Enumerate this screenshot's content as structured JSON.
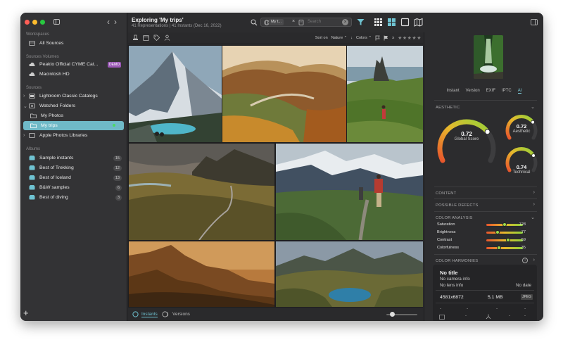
{
  "sidebar": {
    "workspaces_header": "Workspaces",
    "all_sources": "All Sources",
    "sources_volumes_header": "Sources Volumes",
    "volumes": [
      {
        "label": "Peakto Official CYME Cat...",
        "badge": "DEMO"
      },
      {
        "label": "Macintosh HD",
        "badge": ""
      }
    ],
    "sources_header": "Sources",
    "sources": [
      {
        "label": "Lightroom Classic Catalogs"
      },
      {
        "label": "Watched Folders"
      },
      {
        "label": "My Photos"
      },
      {
        "label": "My trips"
      },
      {
        "label": "Apple Photos Libraries"
      }
    ],
    "albums_header": "Albums",
    "albums": [
      {
        "label": "Sample instants",
        "count": "15"
      },
      {
        "label": "Best of Trekking",
        "count": "12"
      },
      {
        "label": "Best of Iceland",
        "count": "13"
      },
      {
        "label": "B&W samples",
        "count": "6"
      },
      {
        "label": "Best of diving",
        "count": "3"
      }
    ],
    "add_label": "+"
  },
  "header": {
    "title": "Exploring 'My trips'",
    "subtitle": "41 Representations | 41 Instants (Dec 16, 2022)",
    "search_chip": "My t...",
    "search_placeholder": "Search"
  },
  "toolbar": {
    "sort_label": "Sort on",
    "sort_value": "Nature",
    "colors_label": "Colors",
    "rating_prefix": "≥",
    "stars": "★★★★★"
  },
  "footer": {
    "instants_label": "Instants",
    "versions_label": "Versions",
    "zoom_fraction": 0.2
  },
  "panel": {
    "tabs": [
      "Instant",
      "Version",
      "EXIF",
      "IPTC",
      "AI"
    ],
    "active_tab": "AI",
    "aesthetic_header": "AESTHETIC",
    "global_score": "0.72",
    "global_score_label": "Global Score",
    "aesthetic_score": "0.72",
    "aesthetic_label": "Aesthetic",
    "technical_score": "0.74",
    "technical_label": "Technical",
    "gauges": {
      "global": 0.72,
      "aesthetic": 0.72,
      "technical": 0.74
    },
    "content_header": "CONTENT",
    "defects_header": "POSSIBLE DEFECTS",
    "color_analysis_header": "COLOR ANALYSIS",
    "color_analysis": [
      {
        "label": "Saturation",
        "value": "128",
        "fraction": 0.5
      },
      {
        "label": "Brightness",
        "value": "77",
        "fraction": 0.3
      },
      {
        "label": "Contrast",
        "value": "59",
        "fraction": 0.6
      },
      {
        "label": "Colorfulness",
        "value": "35",
        "fraction": 0.35
      }
    ],
    "harmonies_header": "COLOR HARMONIES",
    "info": {
      "title": "No title",
      "camera": "No camera info",
      "lens": "No lens info",
      "date": "No date",
      "dimensions": "4581x6872",
      "size": "5,1 MB",
      "format": "JPEG",
      "dashes": [
        "-",
        "-",
        "-",
        "-"
      ]
    }
  }
}
